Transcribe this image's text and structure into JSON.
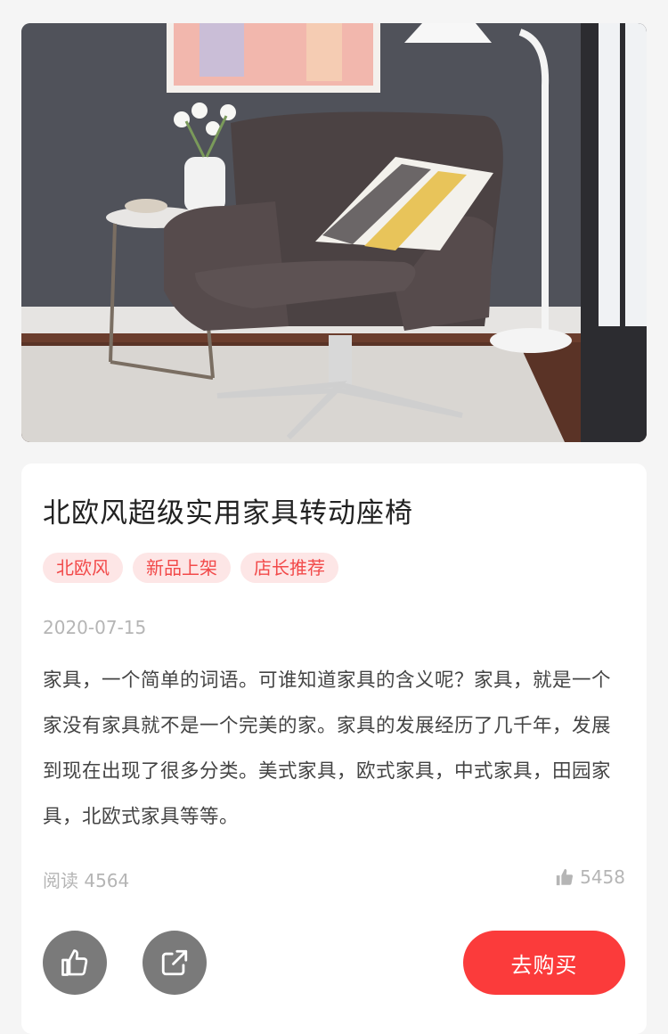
{
  "product": {
    "title": "北欧风超级实用家具转动座椅",
    "tags": [
      "北欧风",
      "新品上架",
      "店长推荐"
    ],
    "date": "2020-07-15",
    "description": "家具，一个简单的词语。可谁知道家具的含义呢？家具，就是一个家没有家具就不是一个完美的家。家具的发展经历了几千年，发展到现在出现了很多分类。美式家具，欧式家具，中式家具，田园家具，北欧式家具等等。",
    "reads": "阅读 4564",
    "likes": "5458"
  },
  "actions": {
    "like_icon": "thumbs-up-icon",
    "share_icon": "share-icon",
    "buy_label": "去购买"
  },
  "colors": {
    "accent": "#fb3b3b",
    "tag_bg": "#fde6e6",
    "tag_text": "#f24a4a",
    "muted": "#b5b5b5"
  }
}
